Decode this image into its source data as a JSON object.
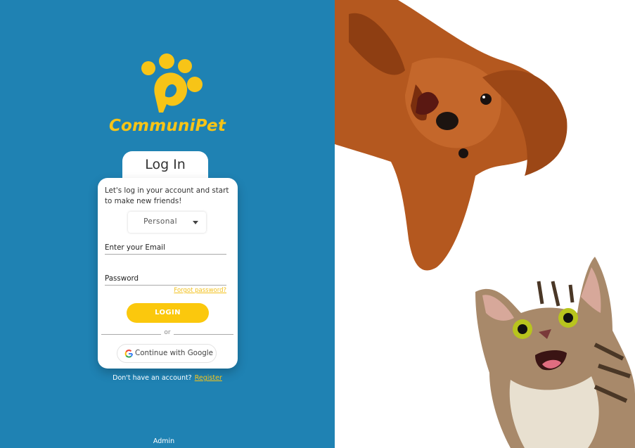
{
  "brand": {
    "name": "CommuniPet",
    "logo_icon": "paw-p-logo",
    "accent_color": "#f7c417",
    "background_color": "#1f82b3"
  },
  "login": {
    "tab_title": "Log In",
    "intro": "Let's log in  your account and start to make new friends!",
    "account_type": {
      "selected": "Personal",
      "icon": "caret-down-icon"
    },
    "email_placeholder": "Enter your Email",
    "password_placeholder": "Password",
    "forgot_password": "Forgot password?",
    "login_button": "LOGIN",
    "divider_text": "or",
    "google_button": "Continue with Google",
    "google_icon": "google-g-icon"
  },
  "footer": {
    "no_account_text": "Don't have an account?",
    "register_link": "Register",
    "admin_link": "Admin"
  },
  "images": {
    "dog": "puppy-photo",
    "cat": "tabby-cat-photo"
  }
}
